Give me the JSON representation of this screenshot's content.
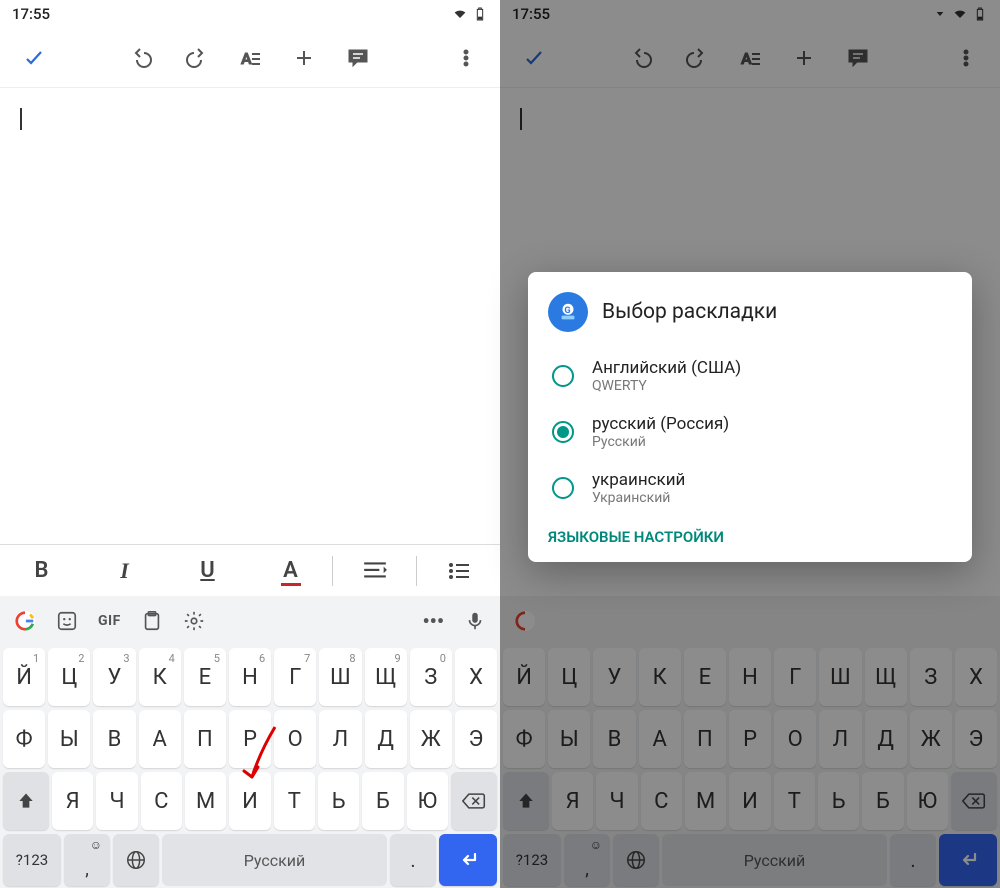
{
  "status": {
    "time": "17:55"
  },
  "toolbar": {
    "check": "✓",
    "undo": "undo",
    "redo": "redo",
    "format": "A̱",
    "add": "+",
    "comment": "comment",
    "overflow": "⋮"
  },
  "editor": {
    "content": ""
  },
  "fmtbar": {
    "bold": "B",
    "italic": "I",
    "underline": "U",
    "fontcolor": "A",
    "align": "align",
    "list": "list"
  },
  "suggest": {
    "google": "G",
    "sticker": "sticker",
    "gif": "GIF",
    "clipboard": "clipboard",
    "settings": "settings",
    "more": "•••",
    "mic": "mic"
  },
  "keyboard": {
    "row1": [
      {
        "k": "Й",
        "s": "1"
      },
      {
        "k": "Ц",
        "s": "2"
      },
      {
        "k": "У",
        "s": "3"
      },
      {
        "k": "К",
        "s": "4"
      },
      {
        "k": "Е",
        "s": "5"
      },
      {
        "k": "Н",
        "s": "6"
      },
      {
        "k": "Г",
        "s": "7"
      },
      {
        "k": "Ш",
        "s": "8"
      },
      {
        "k": "Щ",
        "s": "9"
      },
      {
        "k": "З",
        "s": "0"
      },
      {
        "k": "Х",
        "s": ""
      }
    ],
    "row2": [
      {
        "k": "Ф"
      },
      {
        "k": "Ы"
      },
      {
        "k": "В"
      },
      {
        "k": "А"
      },
      {
        "k": "П"
      },
      {
        "k": "Р"
      },
      {
        "k": "О"
      },
      {
        "k": "Л"
      },
      {
        "k": "Д"
      },
      {
        "k": "Ж"
      },
      {
        "k": "Э"
      }
    ],
    "row3": [
      {
        "k": "Я"
      },
      {
        "k": "Ч"
      },
      {
        "k": "С"
      },
      {
        "k": "М"
      },
      {
        "k": "И"
      },
      {
        "k": "Т"
      },
      {
        "k": "Ь"
      },
      {
        "k": "Б"
      },
      {
        "k": "Ю"
      }
    ],
    "row4": {
      "symbols": "?123",
      "emoji": "☺",
      "comma": ",",
      "globe": "globe",
      "space": "Русский",
      "period": ".",
      "enter": "↵"
    }
  },
  "dialog": {
    "title": "Выбор раскладки",
    "options": [
      {
        "label": "Английский (США)",
        "sub": "QWERTY",
        "selected": false
      },
      {
        "label": "русский (Россия)",
        "sub": "Русский",
        "selected": true
      },
      {
        "label": "украинский",
        "sub": "Украинский",
        "selected": false
      }
    ],
    "action": "ЯЗЫКОВЫЕ НАСТРОЙКИ"
  }
}
